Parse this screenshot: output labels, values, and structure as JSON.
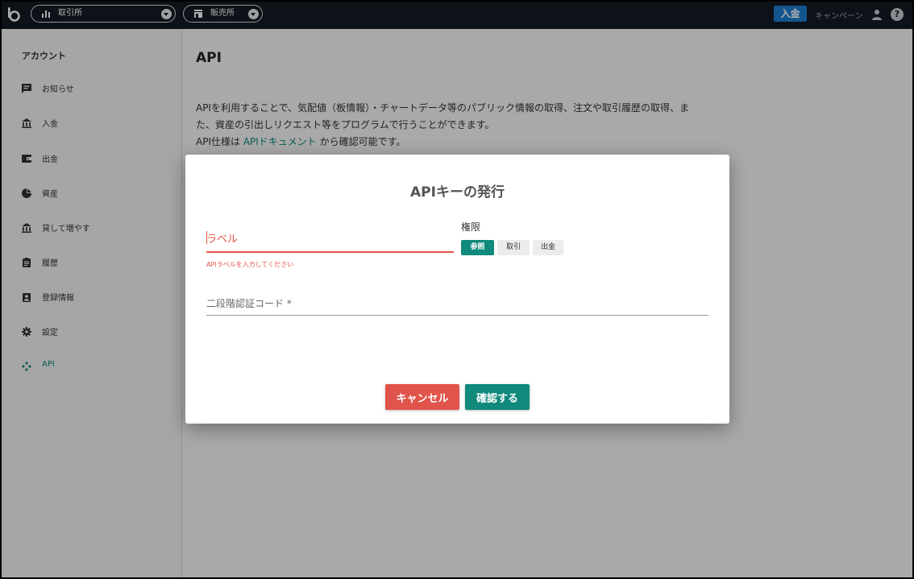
{
  "topbar": {
    "market_selector": "取引所",
    "store_selector": "販売所",
    "deposit_button": "入金",
    "campaign_link": "キャンペーン",
    "help_symbol": "?"
  },
  "sidebar": {
    "heading": "アカウント",
    "items": [
      {
        "label": "お知らせ",
        "icon": "message-icon"
      },
      {
        "label": "入金",
        "icon": "bank-icon"
      },
      {
        "label": "出金",
        "icon": "wallet-icon"
      },
      {
        "label": "資産",
        "icon": "pie-chart-icon"
      },
      {
        "label": "貸して増やす",
        "icon": "bank-icon"
      },
      {
        "label": "履歴",
        "icon": "clipboard-icon"
      },
      {
        "label": "登録情報",
        "icon": "contact-icon"
      },
      {
        "label": "設定",
        "icon": "gear-icon"
      },
      {
        "label": "API",
        "icon": "api-icon",
        "active": true
      }
    ]
  },
  "main": {
    "title": "API",
    "description_line1": "APIを利用することで、気配値（板情報）・チャートデータ等のパブリック情報の取得、注文や取引履歴の取得、ま",
    "description_line2": "た、資産の引出しリクエスト等をプログラムで行うことができます。",
    "spec_prefix": "API仕様は ",
    "spec_link": "APIドキュメント",
    "spec_suffix": " から確認可能です。"
  },
  "modal": {
    "title": "APIキーの発行",
    "label_placeholder": "ラベル",
    "label_value": "",
    "label_error": "APIラベルを入力してください",
    "permissions_title": "権限",
    "permissions": [
      {
        "label": "参照",
        "selected": true
      },
      {
        "label": "取引",
        "selected": false
      },
      {
        "label": "出金",
        "selected": false
      }
    ],
    "twofa_placeholder": "二段階認証コード *",
    "twofa_value": "",
    "cancel_button": "キャンセル",
    "confirm_button": "確認する"
  },
  "colors": {
    "accent": "#0f8a7c",
    "error": "#e4534a",
    "deposit": "#1d7fd1",
    "topbar": "#141a24"
  }
}
